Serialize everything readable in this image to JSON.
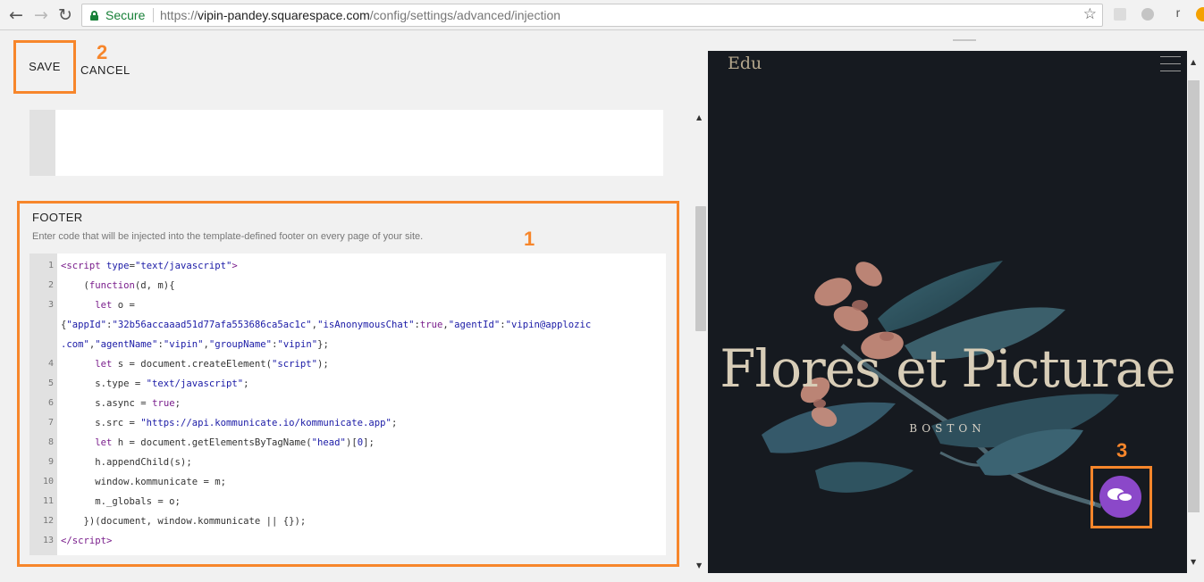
{
  "browser": {
    "back_glyph": "←",
    "forward_glyph": "→",
    "reload_glyph": "↻",
    "secure_label": "Secure",
    "url_scheme": "https://",
    "url_host": "vipin-pandey.squarespace.com",
    "url_path": "/config/settings/advanced/injection",
    "star_glyph": "☆",
    "extension_letter": "r"
  },
  "toolbar": {
    "save_label": "SAVE",
    "cancel_label": "CANCEL"
  },
  "callouts": {
    "save": "2",
    "footer": "1",
    "chat": "3"
  },
  "footer_section": {
    "title": "FOOTER",
    "description": "Enter code that will be injected into the template-defined footer on every page of your site.",
    "lines": [
      {
        "num": "1",
        "html": "<span class=\"tag\">&lt;script</span> <span class=\"attr\">type</span>=<span class=\"str\">\"text/javascript\"</span><span class=\"tag\">&gt;</span>"
      },
      {
        "num": "2",
        "html": "    (<span class=\"kw\">function</span>(d, m){"
      },
      {
        "num": "3",
        "html": "      <span class=\"kw\">let</span> o ="
      },
      {
        "num": "",
        "html": "{<span class=\"str\">\"appId\"</span>:<span class=\"str\">\"32b56accaaad51d77afa553686ca5ac1c\"</span>,<span class=\"str\">\"isAnonymousChat\"</span>:<span class=\"kw\">true</span>,<span class=\"str\">\"agentId\"</span>:<span class=\"str\">\"vipin@applozic</span>"
      },
      {
        "num": "",
        "html": "<span class=\"str\">.com\"</span>,<span class=\"str\">\"agentName\"</span>:<span class=\"str\">\"vipin\"</span>,<span class=\"str\">\"groupName\"</span>:<span class=\"str\">\"vipin\"</span>};"
      },
      {
        "num": "4",
        "html": "      <span class=\"kw\">let</span> s = document.createElement(<span class=\"str\">\"script\"</span>);"
      },
      {
        "num": "5",
        "html": "      s.type = <span class=\"str\">\"text/javascript\"</span>;"
      },
      {
        "num": "6",
        "html": "      s.async = <span class=\"kw\">true</span>;"
      },
      {
        "num": "7",
        "html": "      s.src = <span class=\"str\">\"https://api.kommunicate.io/kommunicate.app\"</span>;"
      },
      {
        "num": "8",
        "html": "      <span class=\"kw\">let</span> h = document.getElementsByTagName(<span class=\"str\">\"head\"</span>)[<span class=\"str\">0</span>];"
      },
      {
        "num": "9",
        "html": "      h.appendChild(s);"
      },
      {
        "num": "10",
        "html": "      window.kommunicate = m;"
      },
      {
        "num": "11",
        "html": "      m._globals = o;"
      },
      {
        "num": "12",
        "html": "    })(document, window.kommunicate || {});"
      },
      {
        "num": "13",
        "html": "<span class=\"tag\">&lt;/script&gt;</span>"
      }
    ]
  },
  "preview": {
    "site_logo": "Edu",
    "hero_title": "Flores et Picturae",
    "hero_subtitle": "BOSTON",
    "chat_button_color": "#8b48c9"
  },
  "colors": {
    "callout": "#f7862b",
    "secure": "#188038",
    "preview_bg": "#161a20"
  }
}
